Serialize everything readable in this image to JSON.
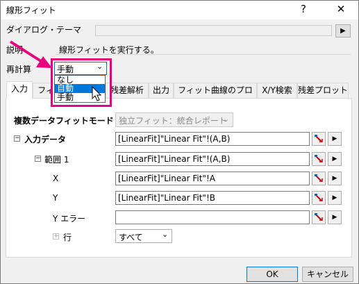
{
  "window": {
    "title": "線形フィット",
    "help_label": "?",
    "close_label": "✕"
  },
  "dialog_theme": {
    "label": "ダイアログ・テーマ",
    "arrow": "▶"
  },
  "description": {
    "label": "説明",
    "text": "線形フィットを実行する。"
  },
  "recalc": {
    "label": "再計算",
    "selected": "手動",
    "chevron": "⌄",
    "options": [
      "なし",
      "自動",
      "手動"
    ],
    "highlighted_index": 1
  },
  "tabs": [
    {
      "label": "入力",
      "active": true
    },
    {
      "label": "フィ"
    },
    {
      "label": "残差解析"
    },
    {
      "label": "出力"
    },
    {
      "label": "フィット曲線のプロット"
    },
    {
      "label": "X/Y検索"
    },
    {
      "label": "残差プロット"
    }
  ],
  "input_panel": {
    "multi_fit_label": "複数データフィットモード",
    "multi_fit_value": "独立フィット：統合レポート",
    "input_data_label": "入力データ",
    "input_data_value": "[LinearFit]\"Linear Fit\"!(A,B)",
    "range_label": "範囲 1",
    "range_value": "[LinearFit]\"Linear Fit\"!(A,B)",
    "x_label": "X",
    "x_value": "[LinearFit]\"Linear Fit\"!A",
    "y_label": "Y",
    "y_value": "[LinearFit]\"Linear Fit\"!B",
    "yerr_label": "Y エラー",
    "yerr_value": "",
    "rows_label": "行",
    "rows_value": "すべて",
    "expand_minus": "−",
    "expand_plus": "+",
    "arrow": "▶"
  },
  "footer": {
    "ok_label": "OK",
    "cancel_label": "キャンセル"
  },
  "colors": {
    "highlight": "#0078d7",
    "annotation": "#e6007e"
  }
}
